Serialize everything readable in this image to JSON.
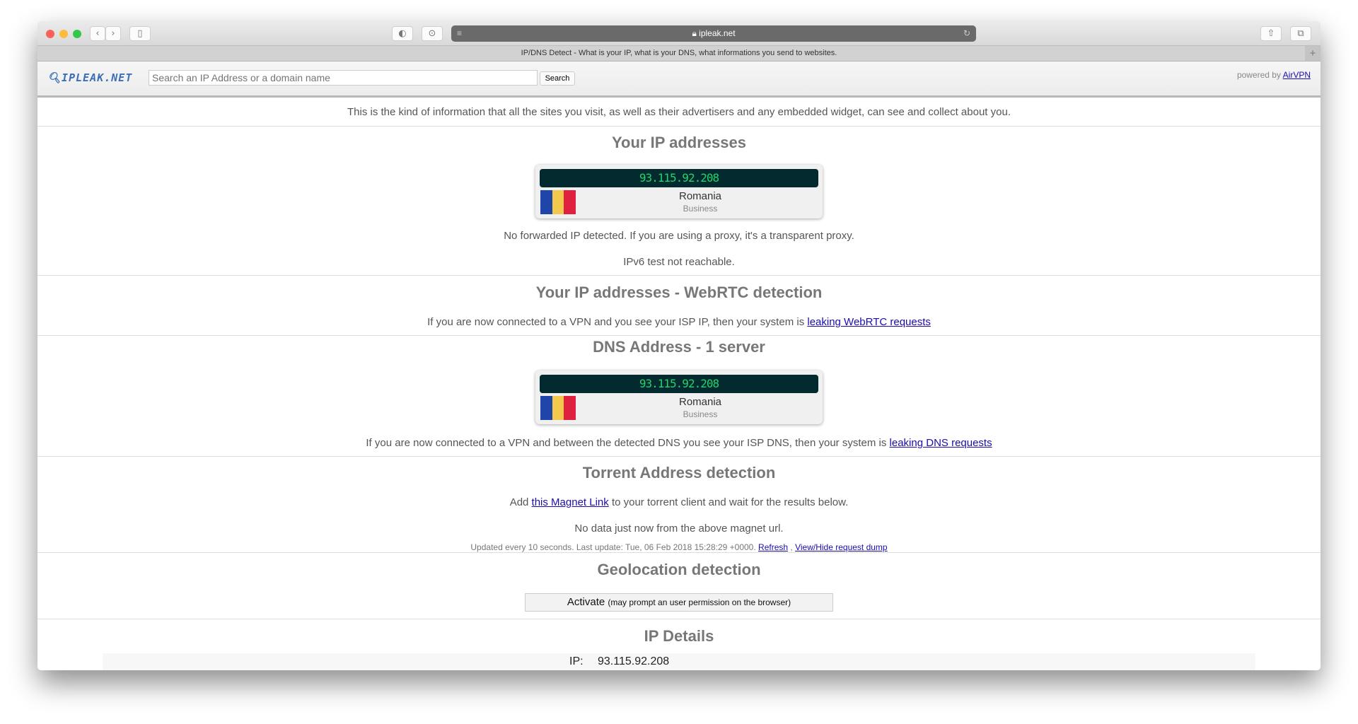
{
  "browser": {
    "url": "ipleak.net",
    "tab_title": "IP/DNS Detect - What is your IP, what is your DNS, what informations you send to websites.",
    "new_tab": "+",
    "colors": {
      "close": "#fc605c",
      "minimize": "#fdbc40",
      "zoom": "#34c84a"
    }
  },
  "header": {
    "logo": "IPLEAK.NET",
    "search_placeholder": "Search an IP Address or a domain name",
    "search_button": "Search",
    "powered_by": "powered by",
    "powered_link": "AirVPN"
  },
  "intro": "This is the kind of information that all the sites you visit, as well as their advertisers and any embedded widget, can see and collect about you.",
  "ip_section": {
    "title": "Your IP addresses",
    "ip": "93.115.92.208",
    "country": "Romania",
    "type": "Business",
    "forwarded": "No forwarded IP detected. If you are using a proxy, it's a transparent proxy.",
    "ipv6": "IPv6 test not reachable."
  },
  "webrtc": {
    "title": "Your IP addresses - WebRTC detection",
    "text": "If you are now connected to a VPN and you see your ISP IP, then your system is ",
    "link": "leaking WebRTC requests"
  },
  "dns": {
    "title": "DNS Address - 1 server",
    "ip": "93.115.92.208",
    "country": "Romania",
    "type": "Business",
    "text": "If you are now connected to a VPN and between the detected DNS you see your ISP DNS, then your system is ",
    "link": "leaking DNS requests"
  },
  "torrent": {
    "title": "Torrent Address detection",
    "pre": "Add ",
    "link": "this Magnet Link",
    "post": " to your torrent client and wait for the results below.",
    "status": "No data just now from the above magnet url.",
    "updated": "Updated every 10 seconds. Last update: Tue, 06 Feb 2018 15:28:29 +0000. ",
    "refresh": "Refresh",
    "sep": " , ",
    "dump": "View/Hide request dump"
  },
  "geo": {
    "title": "Geolocation detection",
    "button": "Activate",
    "note": "(may prompt an user permission on the browser)"
  },
  "details": {
    "title": "IP Details",
    "label": "IP:",
    "value": "93.115.92.208"
  },
  "flag_colors": [
    "#1f45a8",
    "#f2c94c",
    "#e0203f"
  ]
}
